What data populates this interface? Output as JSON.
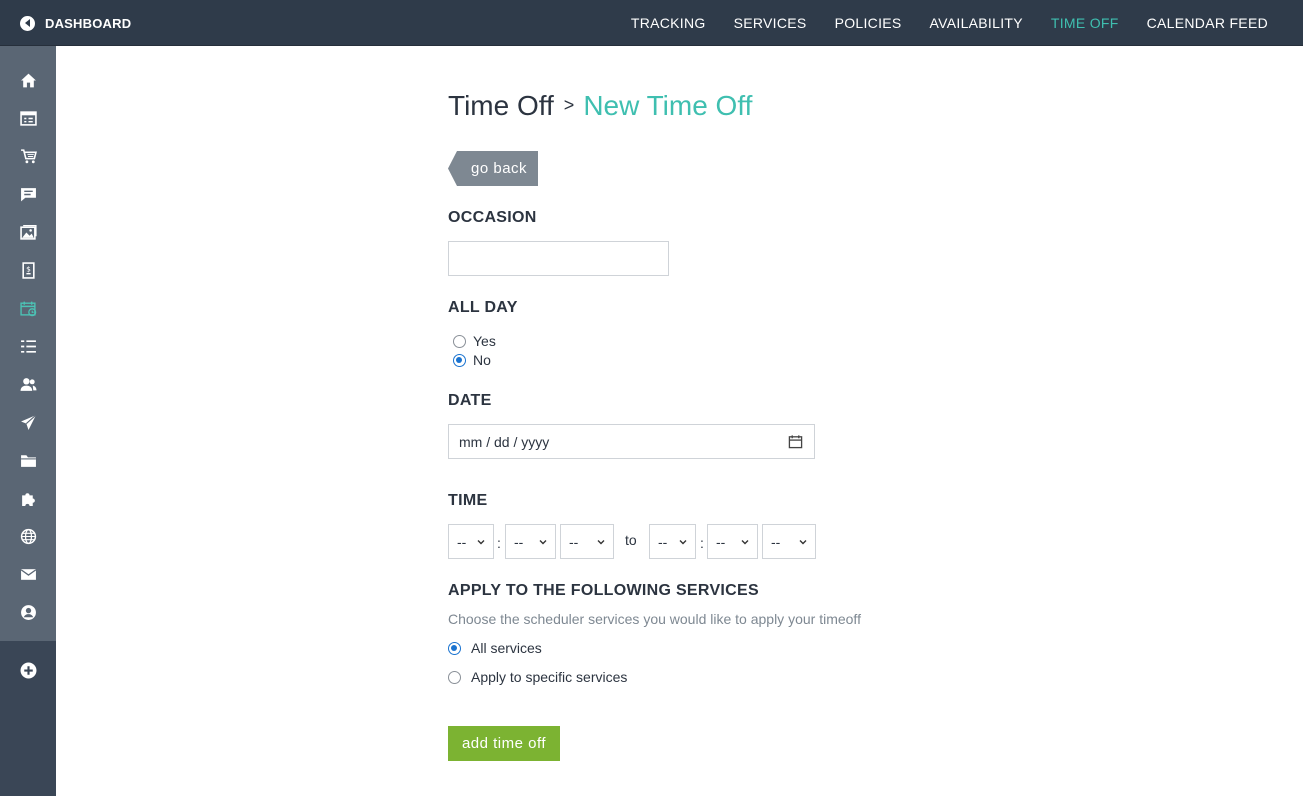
{
  "header": {
    "dashboard_label": "DASHBOARD",
    "nav": [
      {
        "label": "TRACKING",
        "active": false
      },
      {
        "label": "SERVICES",
        "active": false
      },
      {
        "label": "POLICIES",
        "active": false
      },
      {
        "label": "AVAILABILITY",
        "active": false
      },
      {
        "label": "TIME OFF",
        "active": true
      },
      {
        "label": "CALENDAR FEED",
        "active": false
      }
    ]
  },
  "sidebar": {
    "icons": [
      "home-icon",
      "calendar-list-icon",
      "cart-icon",
      "chat-icon",
      "gallery-icon",
      "invoice-icon",
      "scheduler-icon",
      "list-icon",
      "users-icon",
      "send-icon",
      "folder-icon",
      "puzzle-icon",
      "globe-icon",
      "mail-icon",
      "account-icon",
      "add-icon"
    ],
    "active": "scheduler-icon"
  },
  "page": {
    "breadcrumb_parent": "Time Off",
    "breadcrumb_separator": ">",
    "breadcrumb_current": "New Time Off",
    "go_back_label": "go back"
  },
  "form": {
    "occasion_label": "OCCASION",
    "occasion_value": "",
    "all_day_label": "ALL DAY",
    "all_day_options": [
      {
        "label": "Yes",
        "checked": false
      },
      {
        "label": "No",
        "checked": true
      }
    ],
    "date_label": "DATE",
    "date_value": "mm / dd / yyyy",
    "time_label": "TIME",
    "time_from": [
      "--",
      "--",
      "--"
    ],
    "time_to": [
      "--",
      "--",
      "--"
    ],
    "time_separator": ":",
    "time_to_label": "to",
    "services_label": "APPLY TO THE FOLLOWING SERVICES",
    "services_description": "Choose the scheduler services you would like to apply your timeoff",
    "services_options": [
      {
        "label": "All services",
        "checked": true
      },
      {
        "label": "Apply to specific services",
        "checked": false
      }
    ],
    "submit_label": "add time off"
  },
  "colors": {
    "topbar": "#2f3b4a",
    "accent": "#3fbfb0",
    "submit": "#7cb332",
    "go_back": "#7e8892",
    "radio_checked": "#1a73d0"
  }
}
